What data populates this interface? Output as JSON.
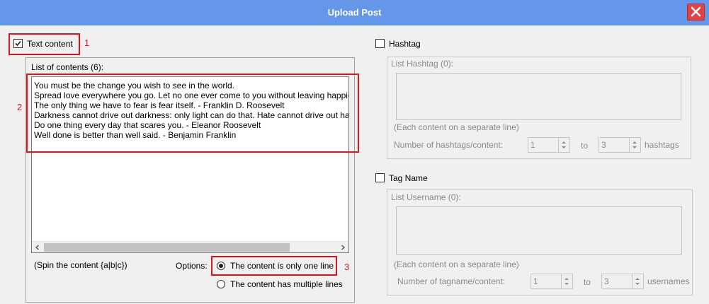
{
  "window": {
    "title": "Upload Post",
    "close_icon": "close-icon"
  },
  "text_content": {
    "label": "Text content",
    "checked": true,
    "marker": "1",
    "list_label": "List of contents (6):",
    "list_marker": "2",
    "lines": [
      "You must be the change you wish to see in the world.",
      "Spread love everywhere you go. Let no one ever come to you without leaving happie",
      "The only thing we have to fear is fear itself. - Franklin D. Roosevelt",
      "Darkness cannot drive out darkness: only light can do that. Hate cannot drive out hat",
      "Do one thing every day that scares you. - Eleanor Roosevelt",
      "Well done is better than well said. - Benjamin Franklin"
    ],
    "spin_hint": "(Spin the content {a|b|c})",
    "options_label": "Options:",
    "option_one_line": "The content is only one line",
    "option_multi_line": "The content has multiple lines",
    "option_marker": "3",
    "selected_option": "one-line"
  },
  "hashtag": {
    "label": "Hashtag",
    "checked": false,
    "list_label": "List Hashtag (0):",
    "hint": "(Each content on a separate line)",
    "count_label": "Number of hashtags/content:",
    "from": "1",
    "to_label": "to",
    "to": "3",
    "unit": "hashtags"
  },
  "tag_name": {
    "label": "Tag Name",
    "checked": false,
    "list_label": "List Username (0):",
    "hint": "(Each content on a separate line)",
    "count_label": "Number of tagname/content:",
    "from": "1",
    "to_label": "to",
    "to": "3",
    "unit": "usernames"
  },
  "colors": {
    "titlebar": "#6496ea",
    "close_button": "#e04343",
    "highlight": "#e0141e"
  }
}
